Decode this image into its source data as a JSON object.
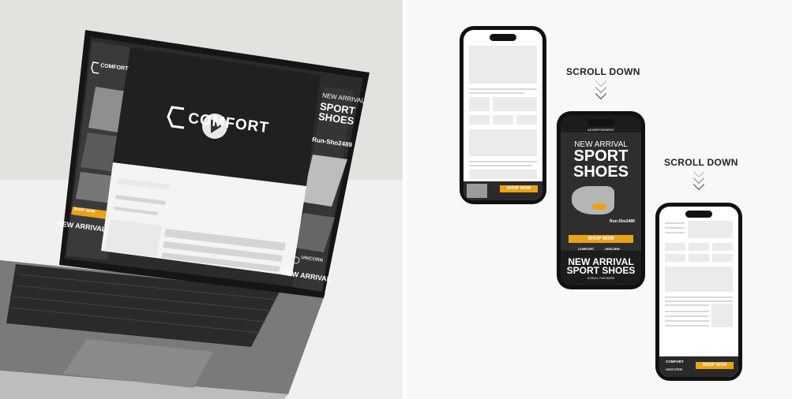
{
  "laptop": {
    "brand_left": "COMFORT",
    "brand_center": "COMFORT",
    "headline_small": "NEW ARRIVAL",
    "headline_big_1": "SPORT",
    "headline_big_2": "SHOES",
    "product_code": "Run-Sho2489",
    "shop_button": "SHOP NOW",
    "partner": "UNICORN",
    "footer_small": "NEW ARRIVAL",
    "footer_sport": "NEW ARRIVAL"
  },
  "scroll": {
    "label_1": "SCROLL DOWN",
    "label_2": "SCROLL DOWN"
  },
  "phone1": {
    "shop_button": "SHOP NOW"
  },
  "phone2": {
    "top_label": "ADVERTISEMENT",
    "headline_small": "NEW ARRIVAL",
    "headline_big_1": "SPORT",
    "headline_big_2": "SHOES",
    "product_code": "Run-Sho2489",
    "shop_button": "SHOP NOW",
    "brand": "COMFORT",
    "partner": "UNICORN",
    "footer_1": "NEW ARRIVAL",
    "footer_2": "SPORT SHOES",
    "footer_small": "SCROLL FOR MORE"
  },
  "phone3": {
    "brand": "COMFORT",
    "partner": "UNICORN",
    "shop_button": "SHOP NOW"
  },
  "colors": {
    "accent": "#e8a317",
    "ad_dark": "#1c1c1c"
  }
}
